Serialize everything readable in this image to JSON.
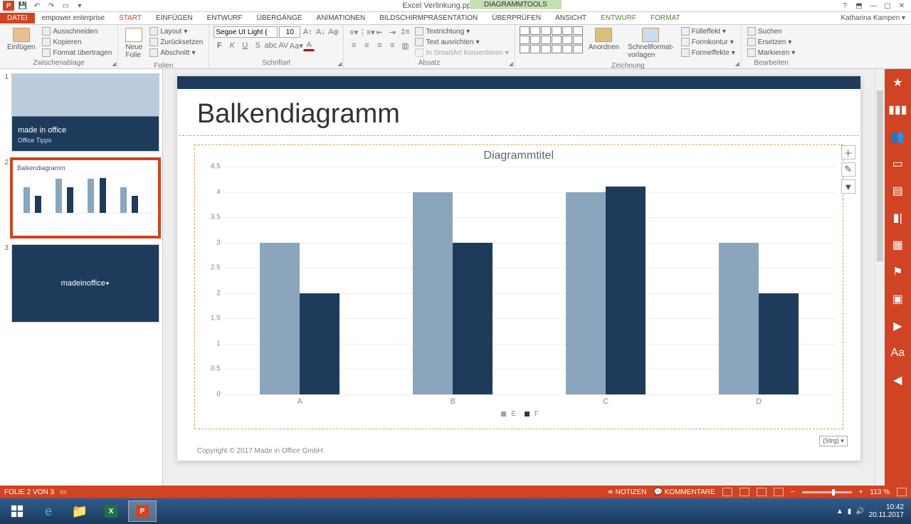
{
  "app": {
    "title": "Excel Verlinkung.pptx - PowerPoint",
    "context_tools": "DIAGRAMMTOOLS",
    "user": "Katharina Kampen"
  },
  "tabs": {
    "file": "DATEI",
    "empower": "empower enterprise",
    "start": "START",
    "insert": "EINFÜGEN",
    "design": "ENTWURF",
    "transitions": "ÜBERGÄNGE",
    "animations": "ANIMATIONEN",
    "slideshow": "BILDSCHIRMPRÄSENTATION",
    "review": "ÜBERPRÜFEN",
    "view": "ANSICHT",
    "ctx_design": "ENTWURF",
    "ctx_format": "FORMAT"
  },
  "ribbon": {
    "clipboard": {
      "label": "Zwischenablage",
      "paste": "Einfügen",
      "cut": "Ausschneiden",
      "copy": "Kopieren",
      "formatpainter": "Format übertragen"
    },
    "slides": {
      "label": "Folien",
      "new": "Neue\nFolie",
      "layout": "Layout",
      "reset": "Zurücksetzen",
      "section": "Abschnitt"
    },
    "font": {
      "label": "Schriftart",
      "name": "Segoe UI Light (",
      "size": "10"
    },
    "paragraph": {
      "label": "Absatz",
      "direction": "Textrichtung",
      "align": "Text ausrichten",
      "smartart": "In SmartArt konvertieren"
    },
    "drawing": {
      "label": "Zeichnung",
      "arrange": "Anordnen",
      "quickstyles": "Schnellformat-\nvorlagen",
      "fill": "Fülleffekt",
      "outline": "Formkontur",
      "effects": "Formeffekte"
    },
    "editing": {
      "label": "Bearbeiten",
      "find": "Suchen",
      "replace": "Ersetzen",
      "select": "Markieren"
    }
  },
  "thumbs": {
    "t1": {
      "num": "1",
      "brand": "made in office",
      "line2": "Office Tipps"
    },
    "t2": {
      "num": "2",
      "title": "Balkendiagramm"
    },
    "t3": {
      "num": "3",
      "text": "madeinoffice"
    }
  },
  "slide": {
    "title": "Balkendiagramm",
    "copyright": "Copyright © 2017 Made in Office GmbH.",
    "strg": "(Strg) ▾"
  },
  "chart_data": {
    "type": "bar",
    "title": "Diagrammtitel",
    "categories": [
      "A",
      "B",
      "C",
      "D"
    ],
    "series": [
      {
        "name": "E",
        "color": "#8ba5bd",
        "values": [
          3,
          4,
          4,
          3
        ]
      },
      {
        "name": "F",
        "color": "#1f3b5c",
        "values": [
          2,
          3,
          4.1,
          2
        ]
      }
    ],
    "ylim": [
      0,
      4.5
    ],
    "yticks": [
      0,
      0.5,
      1,
      1.5,
      2,
      2.5,
      3,
      3.5,
      4,
      4.5
    ]
  },
  "status": {
    "slide": "FOLIE 2 VON 3",
    "notes": "NOTIZEN",
    "comments": "KOMMENTARE",
    "zoom": "113 %"
  },
  "taskbar": {
    "time": "10:42",
    "date": "20.11.2017"
  }
}
